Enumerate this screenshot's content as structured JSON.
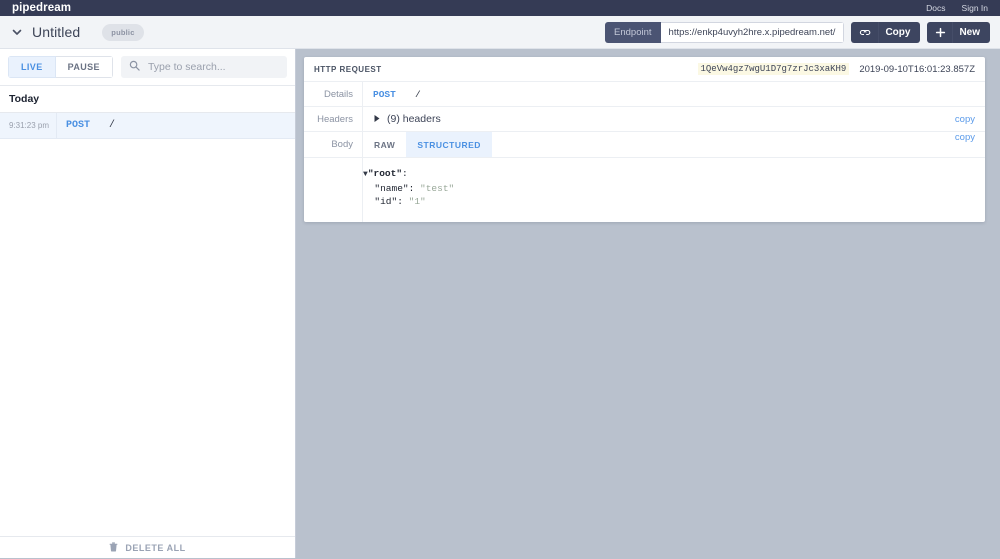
{
  "navbar": {
    "brand": "pipedream",
    "links": [
      {
        "label": "Docs",
        "name": "docs-link"
      },
      {
        "label": "Sign In",
        "name": "sign-in-link"
      }
    ]
  },
  "workflow_bar": {
    "title": "Untitled",
    "visibility_badge": "public",
    "endpoint_label": "Endpoint",
    "endpoint_url": "https://enkp4uvyh2hre.x.pipedream.net/",
    "copy_button": "Copy",
    "new_button": "New"
  },
  "sidebar": {
    "live_button": "LIVE",
    "pause_button": "PAUSE",
    "search_placeholder": "Type to search...",
    "search_value": "",
    "day_header": "Today",
    "events": [
      {
        "time": "9:31:23 pm",
        "method": "POST",
        "path": "/"
      }
    ],
    "delete_all": "DELETE ALL"
  },
  "event_card": {
    "title": "HTTP REQUEST",
    "event_id": "1QeVw4gz7wgU1D7g7zrJc3xaKH9",
    "timestamp": "2019-09-10T16:01:23.857Z",
    "details": {
      "label": "Details",
      "method": "POST",
      "path": "/"
    },
    "headers": {
      "label": "Headers",
      "summary": "(9) headers",
      "copy": "copy"
    },
    "body": {
      "label": "Body",
      "tab_raw": "RAW",
      "tab_structured": "STRUCTURED",
      "active_tab": "STRUCTURED",
      "copy": "copy",
      "json_tree": {
        "root_key": "\"root\"",
        "entries": [
          {
            "key": "\"name\"",
            "value": "\"test\""
          },
          {
            "key": "\"id\"",
            "value": "\"1\""
          }
        ]
      }
    }
  },
  "colors": {
    "navbar": "#353b55",
    "accent_blue": "#4a90e2",
    "canvas": "#b9c1cd",
    "button_dark": "#3d4560"
  }
}
